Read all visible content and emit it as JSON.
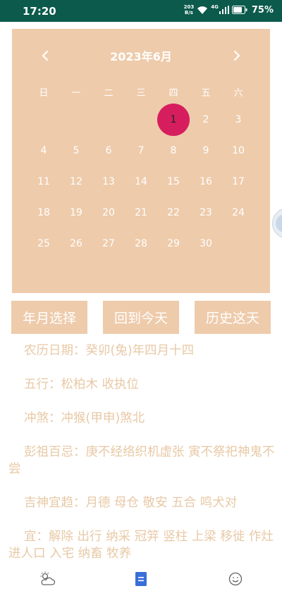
{
  "status_bar": {
    "time": "17:20",
    "net_speed_value": "203",
    "net_speed_unit": "B/s",
    "network": "4G",
    "battery": "75%"
  },
  "calendar": {
    "title": "2023年6月",
    "prev_icon": "chevron-left-icon",
    "next_icon": "chevron-right-icon",
    "weekdays": [
      "日",
      "一",
      "二",
      "三",
      "四",
      "五",
      "六"
    ],
    "weeks": [
      [
        "",
        "",
        "",
        "",
        "1",
        "2",
        "3"
      ],
      [
        "4",
        "5",
        "6",
        "7",
        "8",
        "9",
        "10"
      ],
      [
        "11",
        "12",
        "13",
        "14",
        "15",
        "16",
        "17"
      ],
      [
        "18",
        "19",
        "20",
        "21",
        "22",
        "23",
        "24"
      ],
      [
        "25",
        "26",
        "27",
        "28",
        "29",
        "30",
        ""
      ]
    ],
    "selected_day": "1",
    "selected_color": "#d61e5e",
    "background_color": "#eecbab"
  },
  "buttons": {
    "year_month": "年月选择",
    "today": "回到今天",
    "history": "历史这天"
  },
  "info": {
    "lunar_date": "农历日期：癸卯(兔)年四月十四",
    "five_elements": "五行：松柏木 收执位",
    "clash": "冲煞：冲猴(甲申)煞北",
    "pengzu": "彭祖百忌：庚不经络织机虚张 寅不祭祀神鬼不尝",
    "auspicious_gods": "吉神宜趋：月德 母仓 敬安 五合 鸣犬对",
    "suitable": "宜：解除 出行 纳采 冠笄 竖柱 上梁 移徙 作灶 进人口 入宅 纳畜 牧养"
  },
  "bottom_nav": {
    "items": [
      {
        "icon": "weather-icon"
      },
      {
        "icon": "calendar-icon",
        "active": true
      },
      {
        "icon": "smiley-icon"
      }
    ],
    "active_color": "#3a6ed8"
  }
}
